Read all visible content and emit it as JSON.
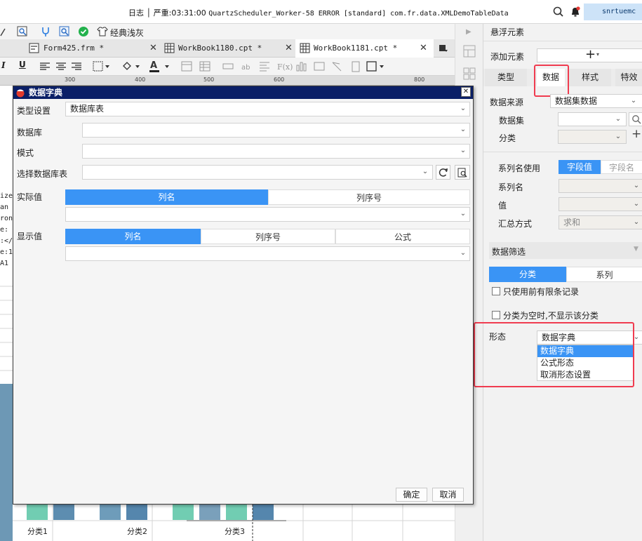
{
  "logbar": {
    "log_label": "日志",
    "severity": "严重:03:31:00",
    "message": "QuartzScheduler_Worker-58 ERROR [standard] com.fr.data.XMLDemoTableData",
    "user": "snrtuemc"
  },
  "toolbar1": {
    "theme_label": "经典浅灰"
  },
  "tabs": [
    {
      "label": "Form425.frm *"
    },
    {
      "label": "WorkBook1180.cpt *"
    },
    {
      "label": "WorkBook1181.cpt *"
    }
  ],
  "ruler": {
    "ticks": [
      "300",
      "400",
      "500",
      "600",
      "800"
    ]
  },
  "sheet": {
    "side_text": [
      "ize",
      "an",
      "ron",
      "e:",
      ":</",
      "e:1",
      "A1"
    ],
    "categories": [
      "分类1",
      "分类2",
      "分类3"
    ]
  },
  "dialog": {
    "title": "数据字典",
    "type_label": "类型设置",
    "type_value": "数据库表",
    "db_label": "数据库",
    "schema_label": "模式",
    "table_label": "选择数据库表",
    "actual_label": "实际值",
    "actual_tabs": [
      "列名",
      "列序号"
    ],
    "display_label": "显示值",
    "display_tabs": [
      "列名",
      "列序号",
      "公式"
    ],
    "ok": "确定",
    "cancel": "取消"
  },
  "panel": {
    "title": "悬浮元素",
    "add_label": "添加元素",
    "tabs": [
      "类型",
      "数据",
      "样式",
      "特效"
    ],
    "source_label": "数据来源",
    "source_value": "数据集数据",
    "dataset_label": "数据集",
    "category_label": "分类",
    "series_use_label": "系列名使用",
    "series_use_options": [
      "字段值",
      "字段名"
    ],
    "series_name_label": "系列名",
    "value_label": "值",
    "summary_label": "汇总方式",
    "summary_value": "求和",
    "filter_label": "数据筛选",
    "filter_tabs": [
      "分类",
      "系列"
    ],
    "only_first_label": "只使用前有限条记录",
    "hide_empty_label": "分类为空时,不显示该分类",
    "form_label": "形态",
    "form_value": "数据字典",
    "form_options": [
      "数据字典",
      "公式形态",
      "取消形态设置"
    ]
  },
  "colors": {
    "accent": "#3a94f5",
    "dialog_title": "#0a1f67",
    "highlight": "#f03c50"
  }
}
